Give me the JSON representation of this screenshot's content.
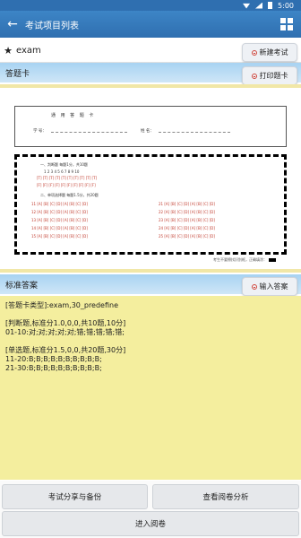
{
  "status": {
    "time": "5:00"
  },
  "app_bar": {
    "title": "考试项目列表"
  },
  "exam_select": {
    "value": "exam"
  },
  "buttons": {
    "new_exam": "新建考试",
    "print_card": "打印题卡",
    "input_answer": "输入答案",
    "share_backup": "考试分享与备份",
    "view_analysis": "查看阅卷分析",
    "enter_grading": "进入阅卷"
  },
  "sections": {
    "answer_card": "答题卡",
    "standard_answer": "标准答案"
  },
  "sheet": {
    "title": "通 用 答 题 卡",
    "id_label": "学 号：",
    "name_label": "姓 名：",
    "tf_heading": "一、判断题 每题1分，共10题",
    "tf_numbers": "1  2  3  4  5        6  7  8  9  10",
    "tf_row1": "[T] [T] [T] [T] [T]    [T] [T] [T] [T] [T]",
    "tf_row2": "[F] [F] [F] [F] [F]    [F] [F] [F] [F] [F]",
    "mc_heading": "二、单项选择题 每题1.5分，共20题",
    "mc_rows": [
      {
        "left": "11 [A] [B] [C] [D]      [A] [B] [C] [D]",
        "right": "21 [A] [B] [C] [D]      [A] [B] [C] [D]"
      },
      {
        "left": "12 [A] [B] [C] [D]      [A] [B] [C] [D]",
        "right": "22 [A] [B] [C] [D]      [A] [B] [C] [D]"
      },
      {
        "left": "13 [A] [B] [C] [D]      [A] [B] [C] [D]",
        "right": "23 [A] [B] [C] [D]      [A] [B] [C] [D]"
      },
      {
        "left": "14 [A] [B] [C] [D]      [A] [B] [C] [D]",
        "right": "24 [A] [B] [C] [D]      [A] [B] [C] [D]"
      },
      {
        "left": "15 [A] [B] [C] [D]      [A] [B] [C] [D]",
        "right": "25 [A] [B] [C] [D]      [A] [B] [C] [D]"
      }
    ],
    "footnote": "考生不要擦拭识别框，正确填涂："
  },
  "standard_answer": {
    "lines": [
      "[答题卡类型]:exam,30_predefine",
      "",
      "[判断题,标准分1.0,0,0,共10题,10分]",
      "01-10:对;对;对;对;对;错;错;错;错;错;",
      "",
      "[单选题,标准分1.5,0,0,共20题,30分]",
      "11-20:B;B;B;B;B;B;B;B;B;B;",
      "21-30:B;B;B;B;B;B;B;B;B;B;"
    ]
  }
}
